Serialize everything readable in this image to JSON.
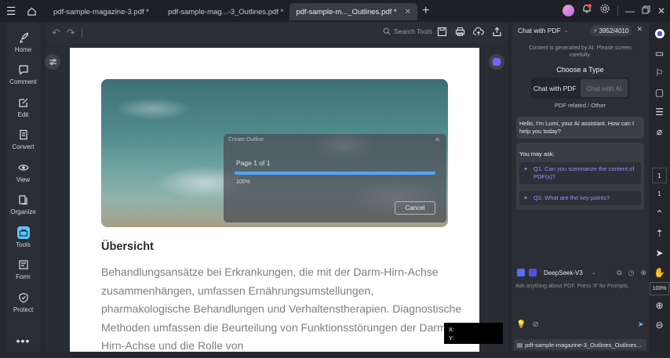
{
  "tabs": [
    {
      "label": "pdf-sample-magazine-3.pdf *",
      "active": false
    },
    {
      "label": "pdf-sample-mag...-3_Outlines.pdf *",
      "active": false
    },
    {
      "label": "pdf-sample-m..._Outlines.pdf *",
      "active": true
    }
  ],
  "left_rail": [
    {
      "label": "Home",
      "icon": "rocket-icon"
    },
    {
      "label": "Comment",
      "icon": "comment-icon"
    },
    {
      "label": "Edit",
      "icon": "edit-icon"
    },
    {
      "label": "Convert",
      "icon": "convert-icon"
    },
    {
      "label": "View",
      "icon": "eye-icon"
    },
    {
      "label": "Organize",
      "icon": "organize-icon"
    },
    {
      "label": "Tools",
      "icon": "toolbox-icon",
      "active": true
    },
    {
      "label": "Form",
      "icon": "form-icon"
    },
    {
      "label": "Protect",
      "icon": "shield-icon"
    }
  ],
  "toolbar": {
    "search_label": "Search Tools"
  },
  "document": {
    "heading": "Übersicht",
    "body": "Behandlungsansätze bei Erkrankungen, die mit der Darm-Hirn-Achse zusammenhängen, umfassen Ernährungsumstellungen, pharmakologische Behandlungen und Verhaltenstherapien. Diagnostische Methoden umfassen die Beurteilung von Funktionsstörungen der Darm-Hirn-Achse und die Rolle von"
  },
  "modal": {
    "title": "Create Outline",
    "page_text": "Page 1 of 1",
    "progress_percent": 100,
    "percent_label": "100%",
    "cancel_label": "Cancel"
  },
  "coords": {
    "x_label": "X:",
    "y_label": "Y:"
  },
  "chat": {
    "mode_label": "Chat with PDF",
    "credits": "3952/4010",
    "disclaimer": "Content is generated by AI. Please screen carefully.",
    "choose_type": "Choose a Type",
    "type_options": [
      {
        "label": "Chat with PDF",
        "active": true
      },
      {
        "label": "Chat with AI",
        "active": false
      }
    ],
    "pdf_related": "PDF related / Other",
    "greeting": "Hello, I'm Lumi, your AI assistant. How can I help you today?",
    "you_may_ask": "You may ask:",
    "suggestions": [
      "Q1. Can you summarize the content of PDF(s)?",
      "Q2. What are the key points?"
    ],
    "model": "DeepSeek-V3",
    "input_placeholder": "Ask anything about PDF. Press '#' for Prompts.",
    "attached_file": "pdf-sample-magazine-3_Outlines_Outlines..."
  },
  "right_rail": {
    "page_current": "1",
    "page_total": "1",
    "zoom": "100%"
  },
  "colors": {
    "accent": "#4ea6f2",
    "tools_active": "#5fc6ff",
    "suggestion_text": "#8a99ff"
  }
}
